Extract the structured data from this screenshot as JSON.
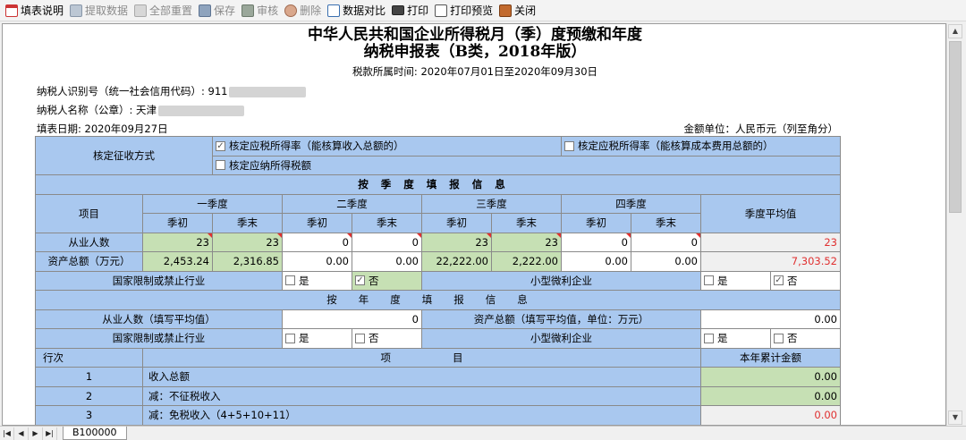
{
  "toolbar": {
    "fill_help": "填表说明",
    "fetch_data": "提取数据",
    "reset_all": "全部重置",
    "save": "保存",
    "audit": "审核",
    "delete": "删除",
    "data_compare": "数据对比",
    "print": "打印",
    "print_preview": "打印预览",
    "close": "关闭"
  },
  "header": {
    "title_line1": "中华人民共和国企业所得税月（季）度预缴和年度",
    "title_line2": "纳税申报表（B类，2018年版）",
    "period": "税款所属时间: 2020年07月01日至2020年09月30日",
    "taxpayer_id": "纳税人识别号（统一社会信用代码）: 911",
    "taxpayer_name": "纳税人名称（公章）: 天津",
    "fill_date": "填表日期: 2020年09月27日",
    "unit": "金额单位：人民币元（列至角分）"
  },
  "collection": {
    "label": "核定征收方式",
    "opt1": "核定应税所得率（能核算收入总额的）",
    "opt1_checked": true,
    "opt2": "核定应税所得率（能核算成本费用总额的）",
    "opt2_checked": false,
    "opt3": "核定应纳所得税额",
    "opt3_checked": false
  },
  "quarterly": {
    "section_title": "按季度填报信息",
    "item_label": "项目",
    "q1": "一季度",
    "q2": "二季度",
    "q3": "三季度",
    "q4": "四季度",
    "start": "季初",
    "end": "季末",
    "avg": "季度平均值",
    "employees_label": "从业人数",
    "employees": [
      "23",
      "23",
      "0",
      "0",
      "23",
      "23",
      "0",
      "0"
    ],
    "employees_avg": "23",
    "assets_label": "资产总额（万元）",
    "assets": [
      "2,453.24",
      "2,316.85",
      "0.00",
      "0.00",
      "22,222.00",
      "2,222.00",
      "0.00",
      "0.00"
    ],
    "assets_avg": "7,303.52",
    "restricted_label": "国家限制或禁止行业",
    "small_label": "小型微利企业",
    "yes": "是",
    "no": "否"
  },
  "annual": {
    "section_title": "按年度填报信息",
    "employees_label": "从业人数（填写平均值）",
    "employees": "0",
    "assets_label": "资产总额（填写平均值，单位：万元）",
    "assets": "0.00",
    "restricted_label": "国家限制或禁止行业",
    "small_label": "小型微利企业",
    "yes": "是",
    "no": "否"
  },
  "lines": {
    "col_row": "行次",
    "col_item": "项　　　　　　目",
    "col_amount": "本年累计金额",
    "rows": [
      {
        "no": "1",
        "item": "收入总额",
        "amount": "0.00",
        "red": false
      },
      {
        "no": "2",
        "item": "减：不征税收入",
        "amount": "0.00",
        "red": false
      },
      {
        "no": "3",
        "item": "减：免税收入（4+5+10+11）",
        "amount": "0.00",
        "red": true
      }
    ]
  },
  "sheet_tab": "B100000"
}
